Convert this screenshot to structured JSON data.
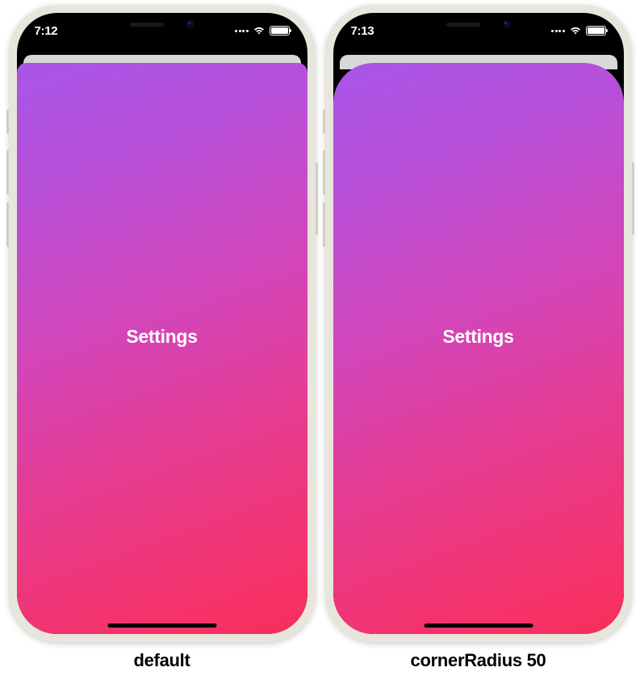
{
  "phones": [
    {
      "status": {
        "time": "7:12"
      },
      "modal": {
        "label": "Settings",
        "cornerRadiusClass": "modal-default"
      },
      "caption": "default"
    },
    {
      "status": {
        "time": "7:13"
      },
      "modal": {
        "label": "Settings",
        "cornerRadiusClass": "modal-cr50"
      },
      "caption": "cornerRadius 50"
    }
  ]
}
